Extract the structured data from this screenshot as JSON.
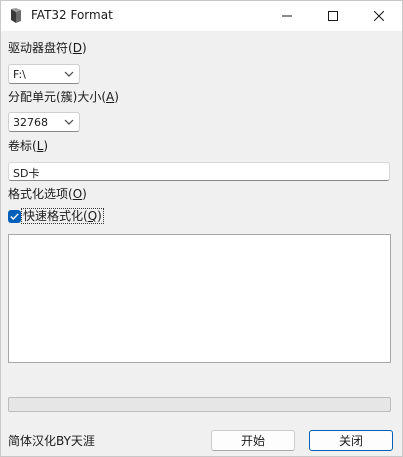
{
  "window": {
    "title": "FAT32 Format"
  },
  "drive": {
    "label_main": "驱动器盘符(",
    "label_key": "D",
    "label_end": ")",
    "value": "F:\\"
  },
  "cluster": {
    "label_main": "分配单元(簇)大小(",
    "label_key": "A",
    "label_end": ")",
    "value": "32768"
  },
  "volume": {
    "label_main": "卷标(",
    "label_key": "L",
    "label_end": ")",
    "value": "SD卡"
  },
  "options": {
    "label_main": "格式化选项(",
    "label_key": "O",
    "label_end": ")",
    "quick_main": "快速格式化(",
    "quick_key": "Q",
    "quick_end": ")",
    "quick_checked": true
  },
  "progress": {
    "value": 0
  },
  "footer": {
    "credit": "简体汉化BY天涯",
    "start_label": "开始",
    "close_label": "关闭"
  },
  "colors": {
    "accent": "#005fb8",
    "progress": "#06b025"
  }
}
